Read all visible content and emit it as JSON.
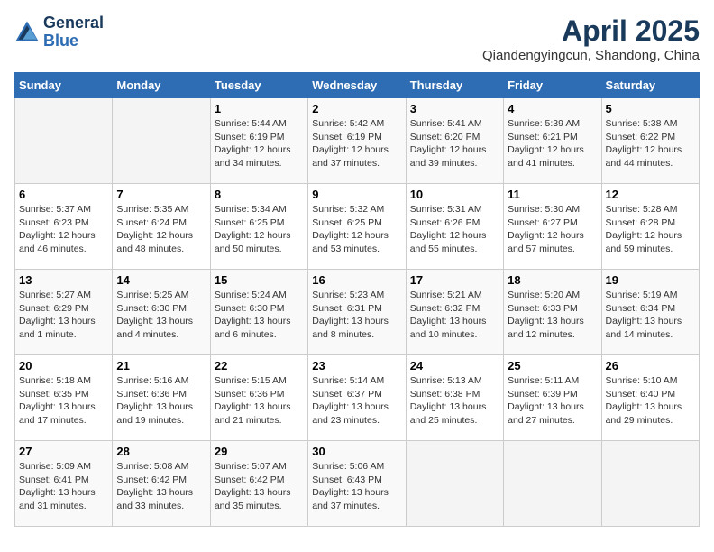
{
  "header": {
    "logo_general": "General",
    "logo_blue": "Blue",
    "month_title": "April 2025",
    "subtitle": "Qiandengyingcun, Shandong, China"
  },
  "weekdays": [
    "Sunday",
    "Monday",
    "Tuesday",
    "Wednesday",
    "Thursday",
    "Friday",
    "Saturday"
  ],
  "weeks": [
    [
      {
        "day": "",
        "info": ""
      },
      {
        "day": "",
        "info": ""
      },
      {
        "day": "1",
        "info": "Sunrise: 5:44 AM\nSunset: 6:19 PM\nDaylight: 12 hours and 34 minutes."
      },
      {
        "day": "2",
        "info": "Sunrise: 5:42 AM\nSunset: 6:19 PM\nDaylight: 12 hours and 37 minutes."
      },
      {
        "day": "3",
        "info": "Sunrise: 5:41 AM\nSunset: 6:20 PM\nDaylight: 12 hours and 39 minutes."
      },
      {
        "day": "4",
        "info": "Sunrise: 5:39 AM\nSunset: 6:21 PM\nDaylight: 12 hours and 41 minutes."
      },
      {
        "day": "5",
        "info": "Sunrise: 5:38 AM\nSunset: 6:22 PM\nDaylight: 12 hours and 44 minutes."
      }
    ],
    [
      {
        "day": "6",
        "info": "Sunrise: 5:37 AM\nSunset: 6:23 PM\nDaylight: 12 hours and 46 minutes."
      },
      {
        "day": "7",
        "info": "Sunrise: 5:35 AM\nSunset: 6:24 PM\nDaylight: 12 hours and 48 minutes."
      },
      {
        "day": "8",
        "info": "Sunrise: 5:34 AM\nSunset: 6:25 PM\nDaylight: 12 hours and 50 minutes."
      },
      {
        "day": "9",
        "info": "Sunrise: 5:32 AM\nSunset: 6:25 PM\nDaylight: 12 hours and 53 minutes."
      },
      {
        "day": "10",
        "info": "Sunrise: 5:31 AM\nSunset: 6:26 PM\nDaylight: 12 hours and 55 minutes."
      },
      {
        "day": "11",
        "info": "Sunrise: 5:30 AM\nSunset: 6:27 PM\nDaylight: 12 hours and 57 minutes."
      },
      {
        "day": "12",
        "info": "Sunrise: 5:28 AM\nSunset: 6:28 PM\nDaylight: 12 hours and 59 minutes."
      }
    ],
    [
      {
        "day": "13",
        "info": "Sunrise: 5:27 AM\nSunset: 6:29 PM\nDaylight: 13 hours and 1 minute."
      },
      {
        "day": "14",
        "info": "Sunrise: 5:25 AM\nSunset: 6:30 PM\nDaylight: 13 hours and 4 minutes."
      },
      {
        "day": "15",
        "info": "Sunrise: 5:24 AM\nSunset: 6:30 PM\nDaylight: 13 hours and 6 minutes."
      },
      {
        "day": "16",
        "info": "Sunrise: 5:23 AM\nSunset: 6:31 PM\nDaylight: 13 hours and 8 minutes."
      },
      {
        "day": "17",
        "info": "Sunrise: 5:21 AM\nSunset: 6:32 PM\nDaylight: 13 hours and 10 minutes."
      },
      {
        "day": "18",
        "info": "Sunrise: 5:20 AM\nSunset: 6:33 PM\nDaylight: 13 hours and 12 minutes."
      },
      {
        "day": "19",
        "info": "Sunrise: 5:19 AM\nSunset: 6:34 PM\nDaylight: 13 hours and 14 minutes."
      }
    ],
    [
      {
        "day": "20",
        "info": "Sunrise: 5:18 AM\nSunset: 6:35 PM\nDaylight: 13 hours and 17 minutes."
      },
      {
        "day": "21",
        "info": "Sunrise: 5:16 AM\nSunset: 6:36 PM\nDaylight: 13 hours and 19 minutes."
      },
      {
        "day": "22",
        "info": "Sunrise: 5:15 AM\nSunset: 6:36 PM\nDaylight: 13 hours and 21 minutes."
      },
      {
        "day": "23",
        "info": "Sunrise: 5:14 AM\nSunset: 6:37 PM\nDaylight: 13 hours and 23 minutes."
      },
      {
        "day": "24",
        "info": "Sunrise: 5:13 AM\nSunset: 6:38 PM\nDaylight: 13 hours and 25 minutes."
      },
      {
        "day": "25",
        "info": "Sunrise: 5:11 AM\nSunset: 6:39 PM\nDaylight: 13 hours and 27 minutes."
      },
      {
        "day": "26",
        "info": "Sunrise: 5:10 AM\nSunset: 6:40 PM\nDaylight: 13 hours and 29 minutes."
      }
    ],
    [
      {
        "day": "27",
        "info": "Sunrise: 5:09 AM\nSunset: 6:41 PM\nDaylight: 13 hours and 31 minutes."
      },
      {
        "day": "28",
        "info": "Sunrise: 5:08 AM\nSunset: 6:42 PM\nDaylight: 13 hours and 33 minutes."
      },
      {
        "day": "29",
        "info": "Sunrise: 5:07 AM\nSunset: 6:42 PM\nDaylight: 13 hours and 35 minutes."
      },
      {
        "day": "30",
        "info": "Sunrise: 5:06 AM\nSunset: 6:43 PM\nDaylight: 13 hours and 37 minutes."
      },
      {
        "day": "",
        "info": ""
      },
      {
        "day": "",
        "info": ""
      },
      {
        "day": "",
        "info": ""
      }
    ]
  ]
}
